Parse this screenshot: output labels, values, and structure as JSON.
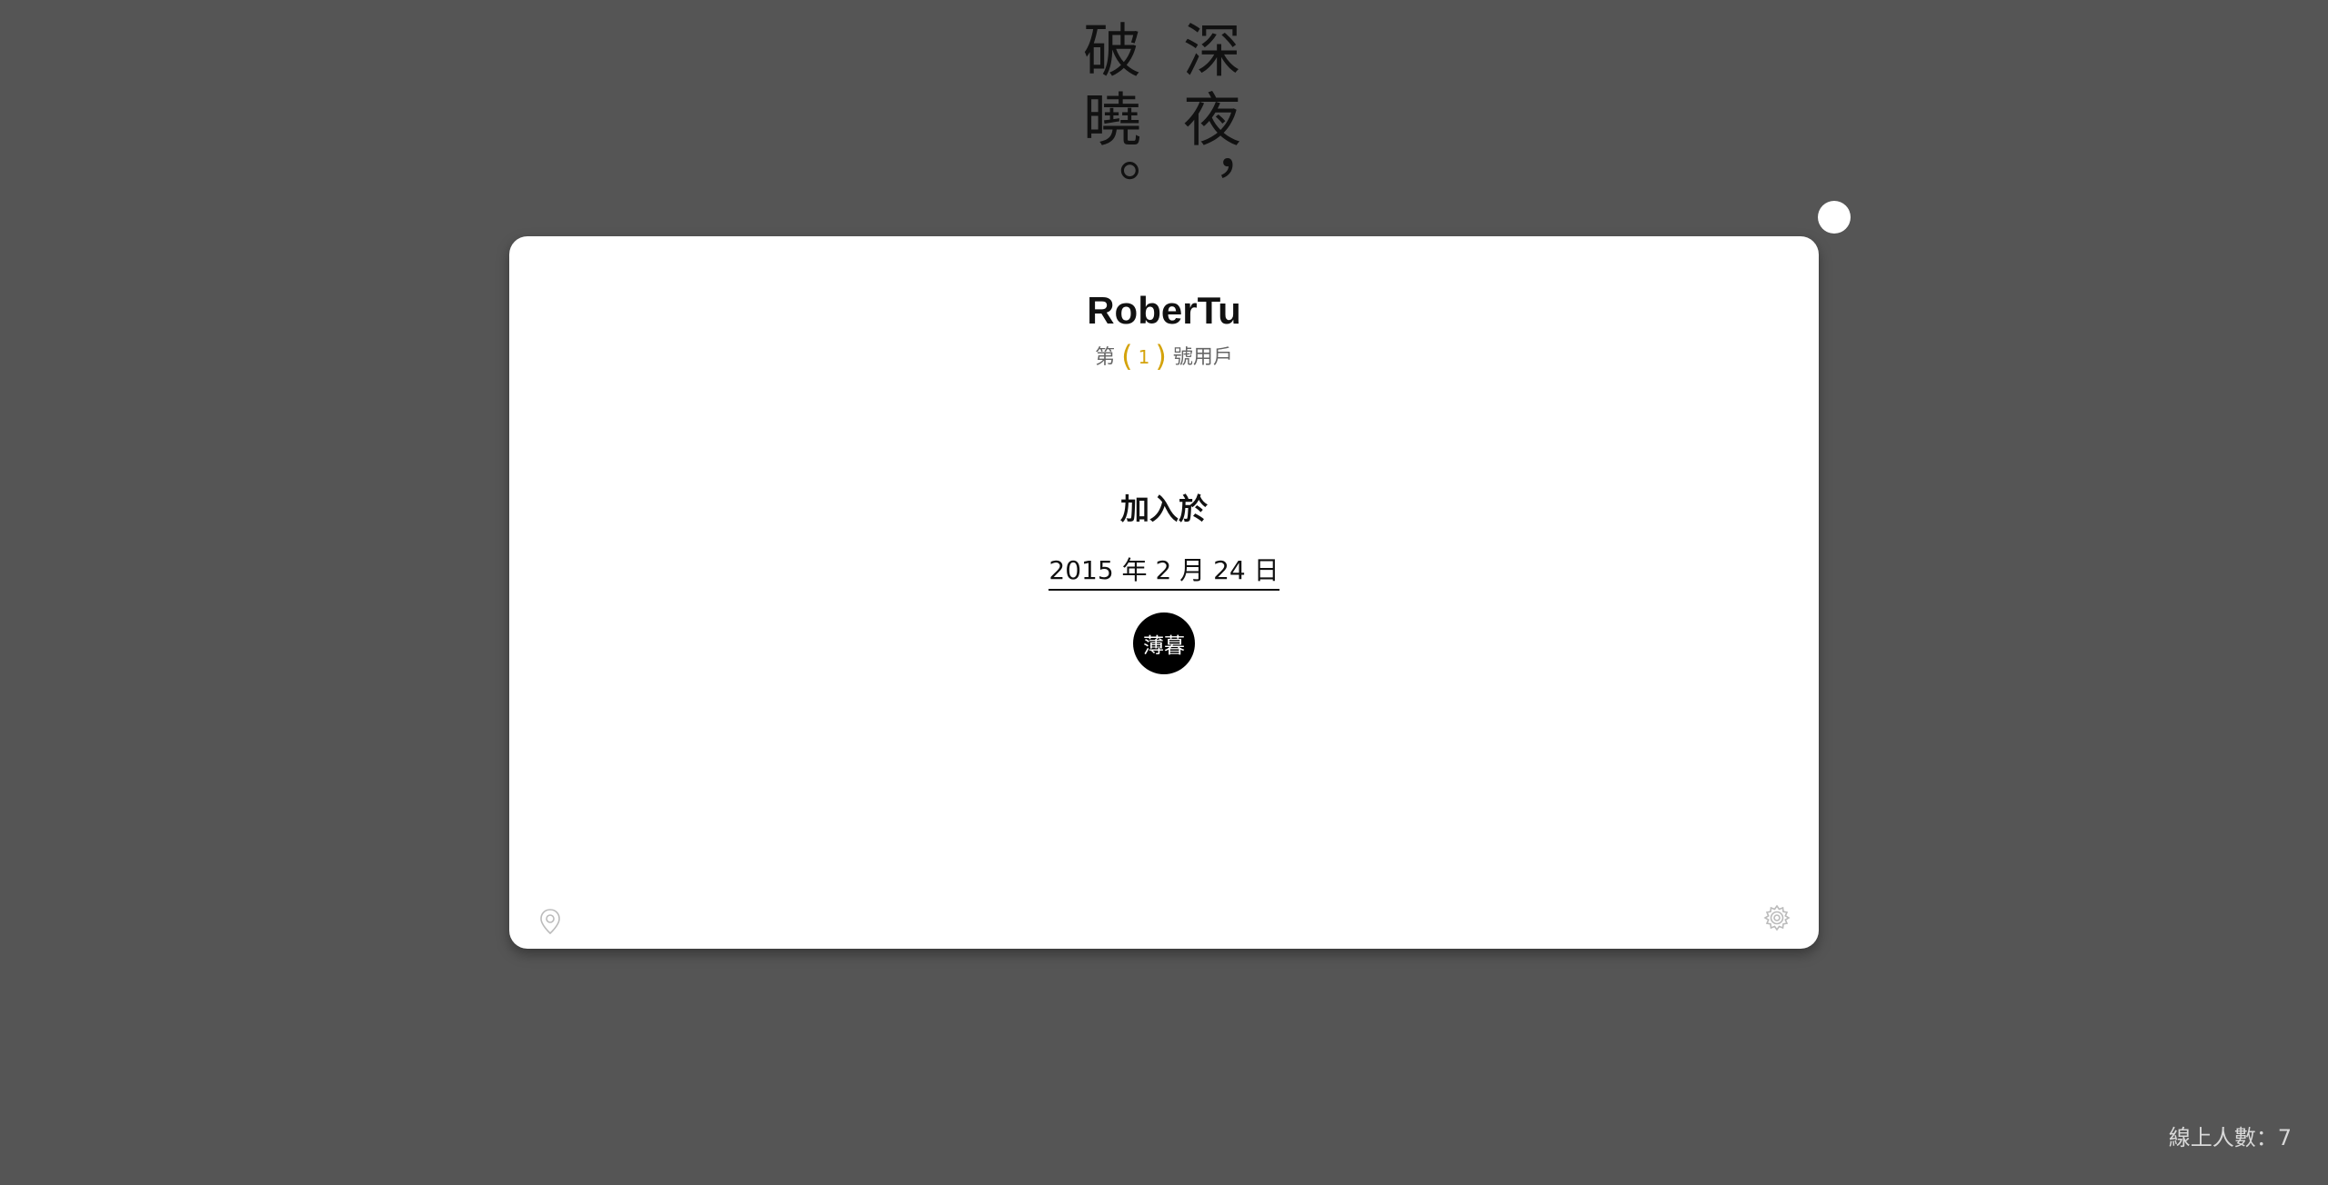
{
  "poem": {
    "right_column": "深夜，",
    "left_column": "破曉。"
  },
  "profile": {
    "username": "RoberTu",
    "rank_prefix": "第",
    "rank_open": "(",
    "rank_number": "1",
    "rank_close": ")",
    "rank_suffix": "號用戶",
    "joined_label": "加入於",
    "joined_date": "2015 年 2 月 24 日",
    "badge_label": "薄暮"
  },
  "footer": {
    "online_count_text": "線上人數：7"
  },
  "icons": {
    "location": "location-pin-icon",
    "settings": "gear-icon",
    "toggle": "toggle-dot"
  },
  "colors": {
    "background": "#555555",
    "card": "#ffffff",
    "accent": "#d4a30c",
    "badge": "#000000"
  }
}
